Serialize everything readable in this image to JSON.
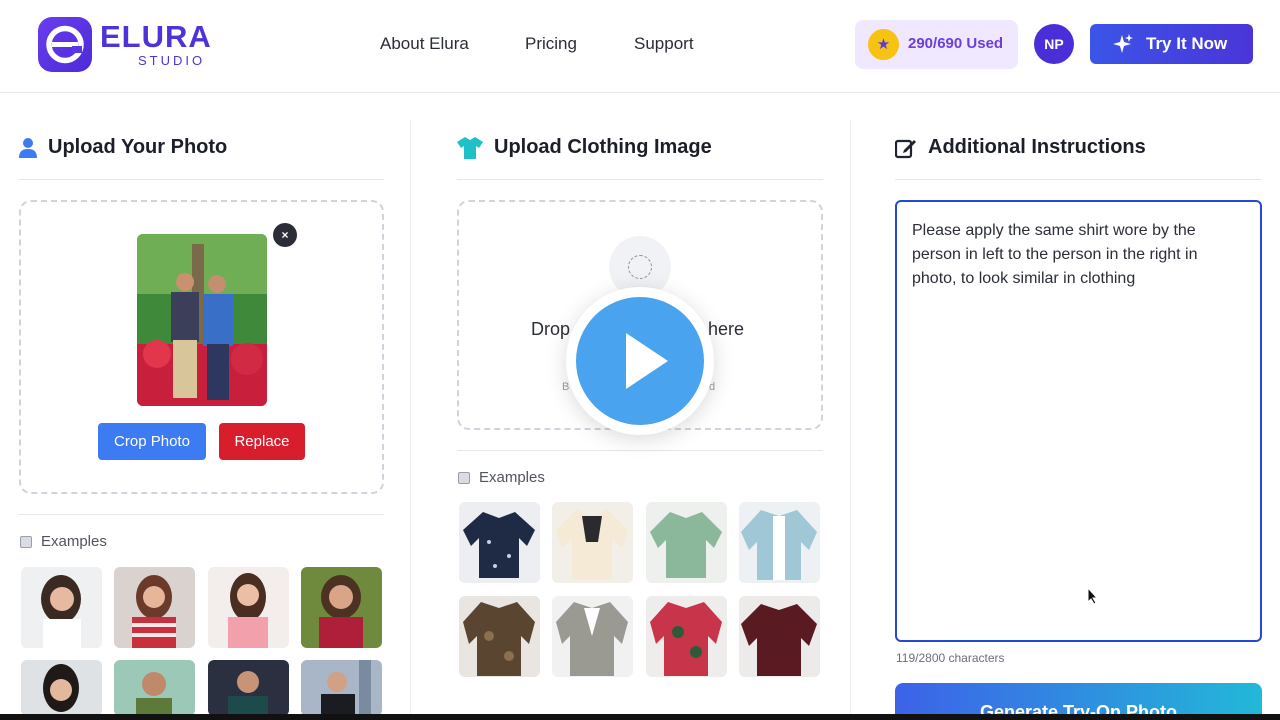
{
  "brand": {
    "name": "ELURA",
    "sub": "STUDIO",
    "color": "#4f33d9"
  },
  "nav": [
    {
      "label": "About Elura"
    },
    {
      "label": "Pricing"
    },
    {
      "label": "Support"
    }
  ],
  "credits": {
    "text": "290/690 Used",
    "icon": "star-icon"
  },
  "user": {
    "initials": "NP"
  },
  "cta": {
    "label": "Try It  Now",
    "icon": "sparkle-icon"
  },
  "photo_section": {
    "title": "Upload Your Photo",
    "icon": "user-icon",
    "close_symbol": "×",
    "crop_label": "Crop Photo",
    "replace_label": "Replace",
    "examples_label": "Examples"
  },
  "clothing_section": {
    "title": "Upload Clothing Image",
    "icon": "tshirt-icon",
    "drop_text_left": "Drop",
    "drop_text_right": "here",
    "drop_sub_left": "B",
    "drop_sub_right": "d",
    "examples_label": "Examples"
  },
  "instructions": {
    "title": "Additional Instructions",
    "icon": "edit-icon",
    "value": "Please apply the same shirt wore by the person in left to the person in the right in photo, to look similar in clothing",
    "char_count": "119/2800 characters",
    "generate_label": "Generate Try-On Photo"
  },
  "colors": {
    "accent": "#3d7bf2",
    "danger": "#d81e2c",
    "focus": "#2449d6",
    "play": "#4aa3ee"
  }
}
